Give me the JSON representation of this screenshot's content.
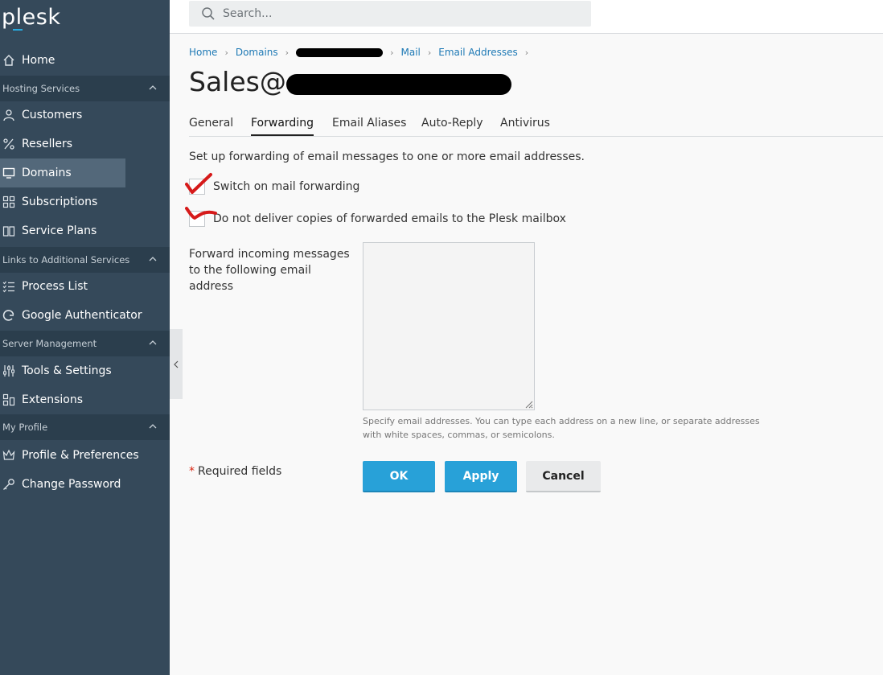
{
  "brand": {
    "logo_text": "plesk",
    "accent": "#28aade"
  },
  "sidebar": {
    "home": "Home",
    "sections": {
      "hosting": "Hosting Services",
      "links": "Links to Additional Services",
      "server": "Server Management",
      "profile": "My Profile"
    },
    "items": {
      "customers": "Customers",
      "resellers": "Resellers",
      "domains": "Domains",
      "subscriptions": "Subscriptions",
      "service_plans": "Service Plans",
      "process_list": "Process List",
      "google_auth": "Google Authenticator",
      "tools": "Tools & Settings",
      "extensions": "Extensions",
      "profile_prefs": "Profile & Preferences",
      "change_password": "Change Password"
    },
    "active_item": "Domains"
  },
  "search": {
    "placeholder": "Search..."
  },
  "breadcrumb": [
    "Home",
    "Domains",
    "Mail",
    "Email Addresses"
  ],
  "page": {
    "title_prefix": "Sales@",
    "tabs": [
      "General",
      "Forwarding",
      "Email Aliases",
      "Auto-Reply",
      "Antivirus"
    ],
    "active_tab": "Forwarding",
    "description": "Set up forwarding of email messages to one or more email addresses.",
    "checkbox_forwarding": "Switch on mail forwarding",
    "checkbox_no_copies": "Do not deliver copies of forwarded emails to the Plesk mailbox",
    "forward_label": "Forward incoming messages to the following email address",
    "forward_value": "",
    "hint": "Specify email addresses. You can type each address on a new line, or separate addresses with white spaces, commas, or semicolons.",
    "required_star": "*",
    "required_text": "Required fields",
    "ok": "OK",
    "apply": "Apply",
    "cancel": "Cancel"
  }
}
